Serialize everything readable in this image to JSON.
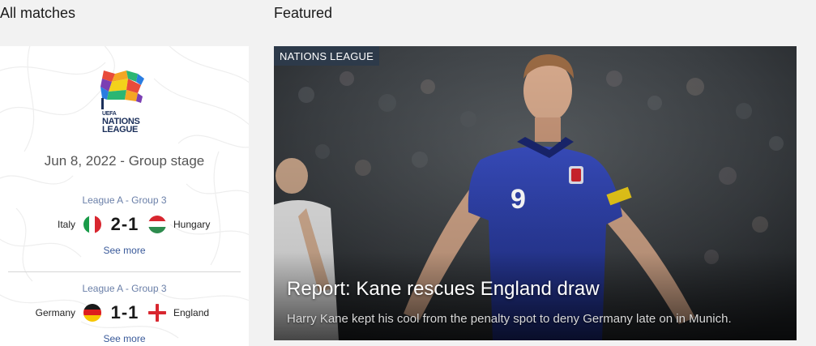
{
  "sections": {
    "all_matches_title": "All matches",
    "featured_title": "Featured"
  },
  "competition": {
    "logo_line1": "UEFA",
    "logo_line2": "NATIONS",
    "logo_line3": "LEAGUE",
    "date_stage": "Jun 8, 2022 - Group stage"
  },
  "matches": [
    {
      "group": "League A - Group 3",
      "home": "Italy",
      "away": "Hungary",
      "score": "2-1",
      "home_flag": "italy-flag",
      "away_flag": "hungary-flag",
      "see_more": "See more"
    },
    {
      "group": "League A - Group 3",
      "home": "Germany",
      "away": "England",
      "score": "1-1",
      "home_flag": "germany-flag",
      "away_flag": "england-flag",
      "see_more": "See more"
    }
  ],
  "featured": {
    "tag": "NATIONS LEAGUE",
    "headline": "Report: Kane rescues England draw",
    "summary": "Harry Kane kept his cool from the penalty spot to deny Germany late on in Munich.",
    "shirt_number": "9"
  },
  "colors": {
    "tag_bg": "#2d3a4a",
    "link": "#3a5a9a",
    "group_label": "#6a7fa8",
    "england_shirt": "#2a3fa6"
  }
}
